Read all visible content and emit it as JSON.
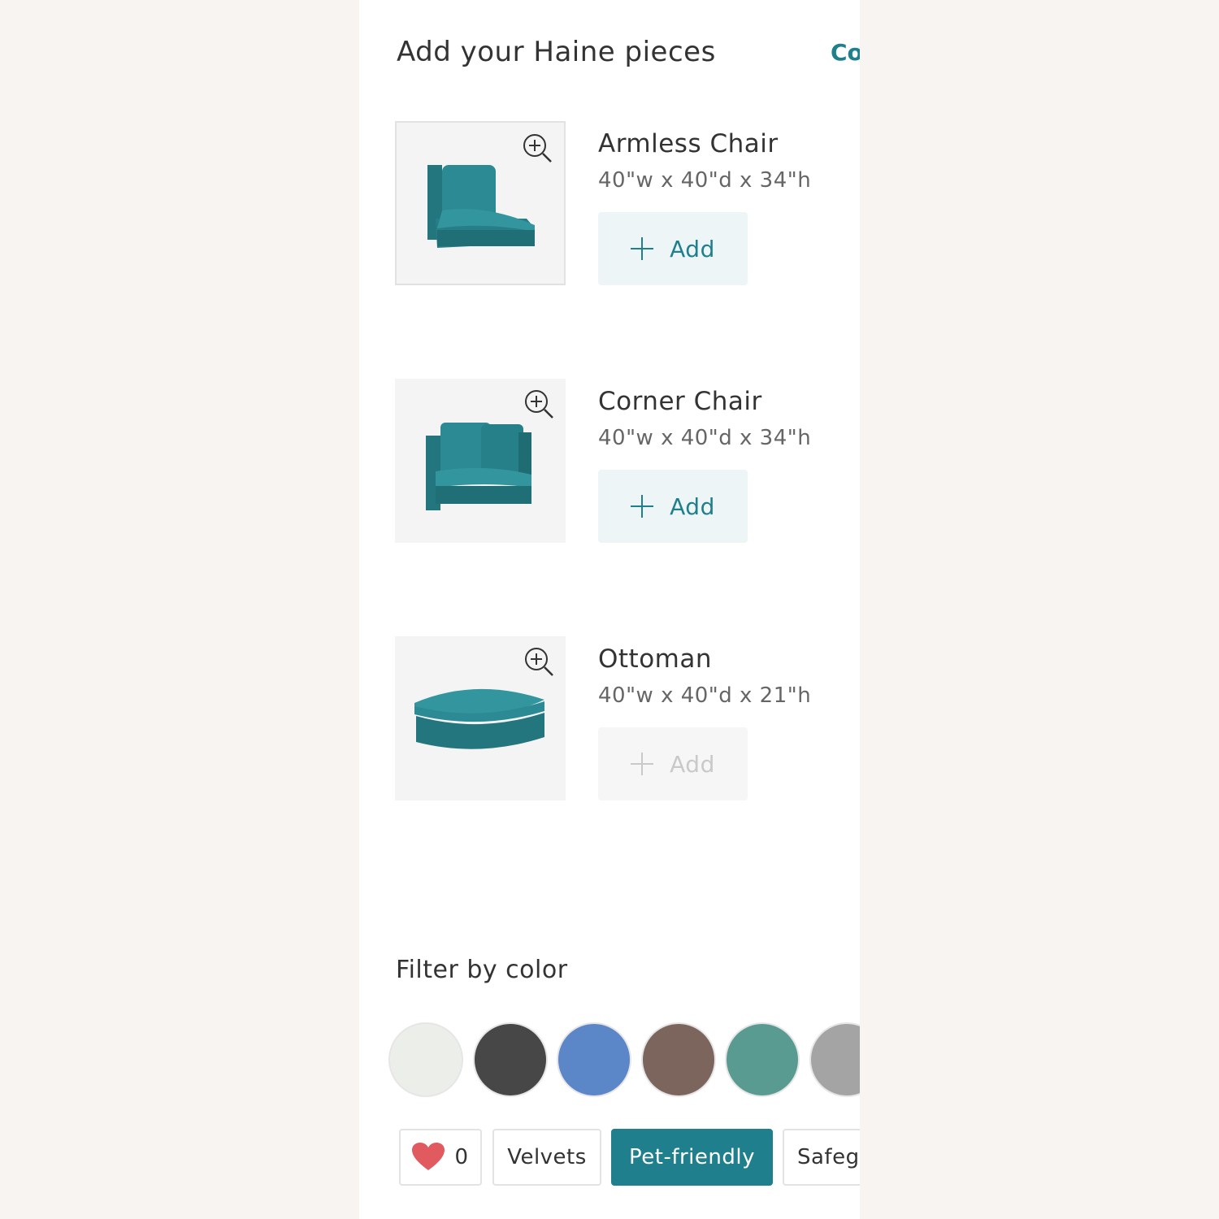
{
  "header": {
    "title": "Add your Haine pieces",
    "link_label": "Co"
  },
  "products": [
    {
      "name": "Armless Chair",
      "dims": "40\"w x 40\"d x 34\"h",
      "add_label": "Add",
      "add_enabled": true
    },
    {
      "name": "Corner Chair",
      "dims": "40\"w x 40\"d x 34\"h",
      "add_label": "Add",
      "add_enabled": true
    },
    {
      "name": "Ottoman",
      "dims": "40\"w x 40\"d x 21\"h",
      "add_label": "Add",
      "add_enabled": false
    }
  ],
  "filter": {
    "title": "Filter by color",
    "colors": [
      "#eceeea",
      "#474747",
      "#5b86c7",
      "#7b655c",
      "#5a9b91",
      "#a4a4a4"
    ]
  },
  "chips": {
    "favorites_count": "0",
    "velvets": "Velvets",
    "pet_friendly": "Pet-friendly",
    "safeguard": "Safeg"
  },
  "colors": {
    "accent": "#1f7f8c",
    "fabric": "#2b8a94",
    "heart": "#e05a5f"
  }
}
